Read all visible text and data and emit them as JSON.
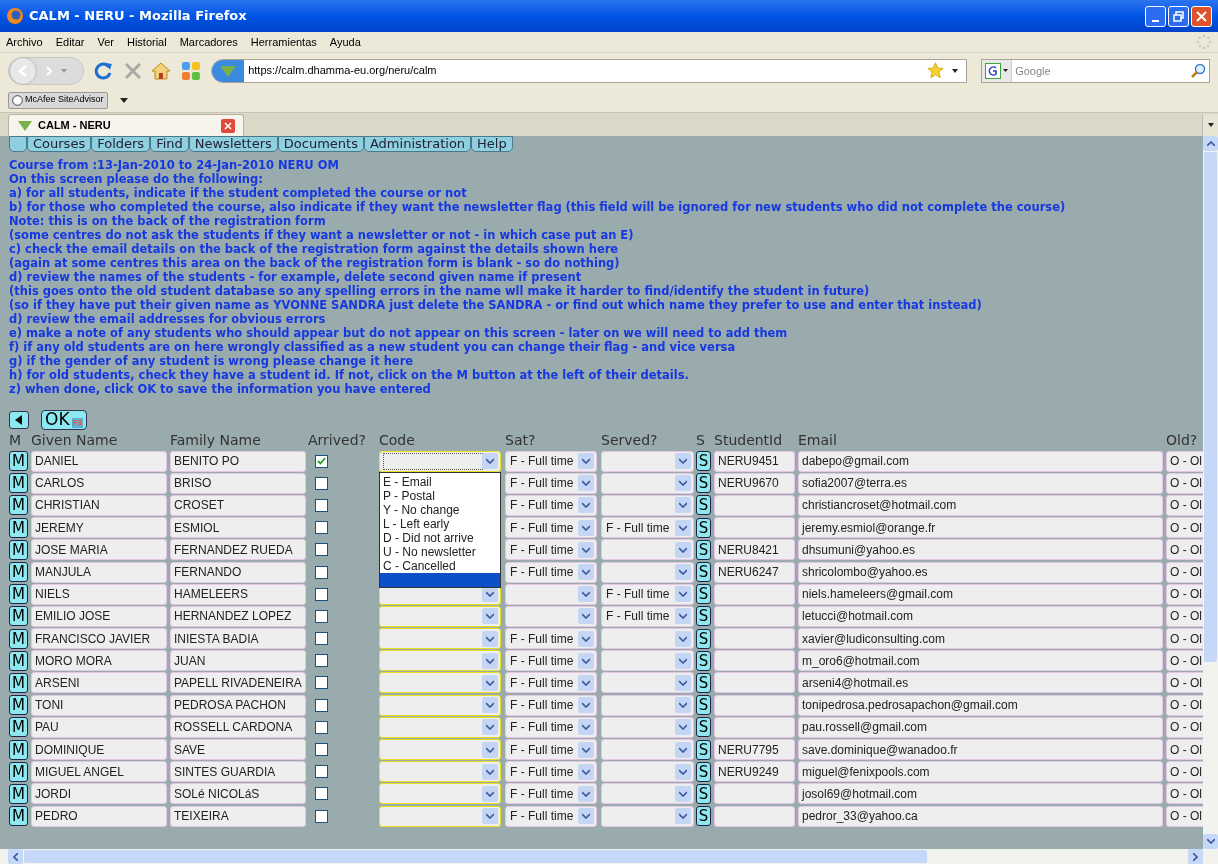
{
  "window": {
    "title": "CALM - NERU - Mozilla Firefox"
  },
  "menu": [
    "Archivo",
    "Editar",
    "Ver",
    "Historial",
    "Marcadores",
    "Herramientas",
    "Ayuda"
  ],
  "toolbar": {
    "url": "https://calm.dhamma-eu.org/neru/calm",
    "search_placeholder": "Google"
  },
  "addon_bar": {
    "label": "McAfee SiteAdvisor"
  },
  "tabs": [
    {
      "label": "CALM - NERU",
      "selected": true
    }
  ],
  "nav_tabs": [
    "Courses",
    "Folders",
    "Find",
    "Newsletters",
    "Documents",
    "Administration",
    "Help"
  ],
  "course_heading": "Course from :13-Jan-2010 to 24-Jan-2010 NERU OM",
  "instructions": [
    "On this screen please do the following:",
    "a) for all students, indicate if the student completed the course or not",
    "b) for those who completed the course, also indicate if they want the newsletter flag (this field will be ignored for new students who did not complete the course)",
    "Note: this is on the back of the registration form",
    "(some centres do not ask the students if they want a newsletter or not - in which case put an E)",
    "c) check the email details on the back of the registration form against the details shown here",
    "(again at some centres this area on the back of the registration form is blank - so do nothing)",
    "d) review the names of the students - for example, delete second given name if present",
    "(this goes onto the old student database so any spelling errors in the name wll make it harder to find/identify the student in future)",
    "(so if they have put their given name as YVONNE SANDRA just delete the SANDRA - or find out which name they prefer to use and enter that instead)",
    "d) review the email addresses for obvious errors",
    "e) make a note of any students who should appear but do not appear on this screen - later on we will need to add them",
    "f) if any old students are on here wrongly classified as a new student you can change their flag - and vice versa",
    "g) if the gender of any student is wrong please change it here",
    "h) for old students, check they have a student id. If not, click on the M button at the left of their details.",
    "z) when done, click OK to save the information you have entered"
  ],
  "ok_button": {
    "label": "OK",
    "shortcut": "F3"
  },
  "table": {
    "columns": [
      "M",
      "Given Name",
      "Family Name",
      "Arrived?",
      "Code",
      "Sat?",
      "Served?",
      "S",
      "StudentId",
      "Email",
      "Old?"
    ],
    "rows": [
      {
        "m_button": "M",
        "s_button": "S",
        "given": "DANIEL",
        "family": "BENITO PO",
        "arrived": true,
        "sat": "F - Full time",
        "student_id": "NERU9451",
        "email": "dabepo@gmail.com",
        "old": "O - Ol"
      },
      {
        "m_button": "M",
        "s_button": "S",
        "given": "CARLOS",
        "family": "BRISO",
        "arrived": false,
        "sat": "F - Full time",
        "student_id": "NERU9670",
        "email": "sofia2007@terra.es",
        "old": "O - Ol"
      },
      {
        "m_button": "M",
        "s_button": "S",
        "given": "CHRISTIAN",
        "family": "CROSET",
        "arrived": false,
        "sat": "F - Full time",
        "email": "christiancroset@hotmail.com",
        "old": "O - Ol"
      },
      {
        "m_button": "M",
        "s_button": "S",
        "given": "JEREMY",
        "family": "ESMIOL",
        "arrived": false,
        "sat": "F - Full time",
        "served": "F - Full time",
        "email": "jeremy.esmiol@orange.fr",
        "old": "O - Ol"
      },
      {
        "m_button": "M",
        "s_button": "S",
        "given": "JOSE MARIA",
        "family": "FERNANDEZ RUEDA",
        "arrived": false,
        "sat": "F - Full time",
        "student_id": "NERU8421",
        "email": "dhsumuni@yahoo.es",
        "old": "O - Ol"
      },
      {
        "m_button": "M",
        "s_button": "S",
        "given": "MANJULA",
        "family": "FERNANDO",
        "arrived": false,
        "sat": "F - Full time",
        "student_id": "NERU6247",
        "email": "shricolombo@yahoo.es",
        "old": "O - Ol"
      },
      {
        "m_button": "M",
        "s_button": "S",
        "given": "NIELS",
        "family": "HAMELEERS",
        "arrived": false,
        "served": "F - Full time",
        "email": "niels.hameleers@gmail.com",
        "old": "O - Ol"
      },
      {
        "m_button": "M",
        "s_button": "S",
        "given": "EMILIO JOSE",
        "family": "HERNANDEZ LOPEZ",
        "arrived": false,
        "served": "F - Full time",
        "email": "letucci@hotmail.com",
        "old": "O - Ol"
      },
      {
        "m_button": "M",
        "s_button": "S",
        "given": "FRANCISCO JAVIER",
        "family": "INIESTA BADIA",
        "arrived": false,
        "sat": "F - Full time",
        "email": "xavier@ludiconsulting.com",
        "old": "O - Ol"
      },
      {
        "m_button": "M",
        "s_button": "S",
        "given": "MORO MORA",
        "family": "JUAN",
        "arrived": false,
        "sat": "F - Full time",
        "email": "m_oro6@hotmail.com",
        "old": "O - Ol"
      },
      {
        "m_button": "M",
        "s_button": "S",
        "given": "ARSENI",
        "family": "PAPELL RIVADENEIRA",
        "arrived": false,
        "sat": "F - Full time",
        "email": "arseni4@hotmail.es",
        "old": "O - Ol"
      },
      {
        "m_button": "M",
        "s_button": "S",
        "given": "TONI",
        "family": "PEDROSA PACHON",
        "arrived": false,
        "sat": "F - Full time",
        "email": "tonipedrosa.pedrosapachon@gmail.com",
        "old": "O - Ol"
      },
      {
        "m_button": "M",
        "s_button": "S",
        "given": "PAU",
        "family": "ROSSELL CARDONA",
        "arrived": false,
        "sat": "F - Full time",
        "email": "pau.rossell@gmail.com",
        "old": "O - Ol"
      },
      {
        "m_button": "M",
        "s_button": "S",
        "given": "DOMINIQUE",
        "family": "SAVE",
        "arrived": false,
        "sat": "F - Full time",
        "student_id": "NERU7795",
        "email": "save.dominique@wanadoo.fr",
        "old": "O - Ol"
      },
      {
        "m_button": "M",
        "s_button": "S",
        "given": "MIGUEL ANGEL",
        "family": "SINTES GUARDIA",
        "arrived": false,
        "sat": "F - Full time",
        "student_id": "NERU9249",
        "email": "miguel@fenixpools.com",
        "old": "O - Ol"
      },
      {
        "m_button": "M",
        "s_button": "S",
        "given": "JORDI",
        "family": "SOLé NICOLáS",
        "arrived": false,
        "sat": "F - Full time",
        "email": "josol69@hotmail.com",
        "old": "O - Ol"
      },
      {
        "m_button": "M",
        "s_button": "S",
        "given": "PEDRO",
        "family": "TEIXEIRA",
        "arrived": false,
        "sat": "F - Full time",
        "email": "pedror_33@yahoo.ca",
        "old": "O - Ol"
      }
    ],
    "code_dropdown": {
      "open": true,
      "options": [
        {
          "label": "E - Email",
          "highlighted": false
        },
        {
          "label": "P - Postal",
          "highlighted": false
        },
        {
          "label": "Y - No change",
          "highlighted": false
        },
        {
          "label": "L - Left early",
          "highlighted": false
        },
        {
          "label": "D - Did not arrive",
          "highlighted": false
        },
        {
          "label": "U - No newsletter",
          "highlighted": false
        },
        {
          "label": "C - Cancelled",
          "highlighted": false
        },
        {
          "highlighted": true
        }
      ]
    }
  }
}
